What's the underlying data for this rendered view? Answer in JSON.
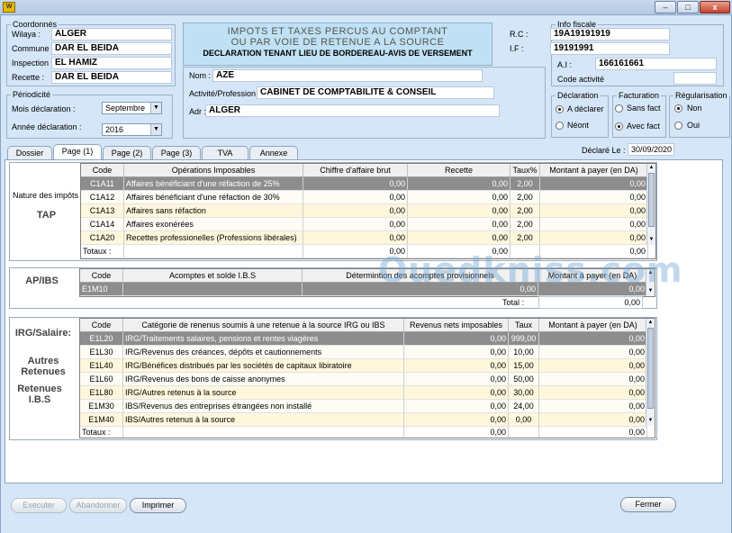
{
  "window": {
    "buttons": {
      "minimize": "–",
      "maximize": "□",
      "close": "x"
    }
  },
  "coordonnees": {
    "legend": "Coordonnés",
    "wilaya_label": "Wilaya :",
    "wilaya": "ALGER",
    "commune_label": "Commune :",
    "commune": "DAR EL BEIDA",
    "inspection_label": "Inspection :",
    "inspection": "EL HAMIZ",
    "recette_label": "Recette :",
    "recette": "DAR EL BEIDA"
  },
  "header": {
    "line1": "IMPOTS ET TAXES PERCUS AU COMPTANT",
    "line2": "OU PAR VOIE DE RETENUE A LA SOURCE",
    "line3": "DECLARATION TENANT LIEU DE BORDEREAU-AVIS DE VERSEMENT"
  },
  "identite": {
    "nom_label": "Nom :",
    "nom": "AZE",
    "activite_label": "Activité/Profession :",
    "activite": "CABINET DE COMPTABILITE & CONSEIL",
    "adr_label": "Adr :",
    "adr": "ALGER"
  },
  "info_fiscale": {
    "legend": "Info fiscale",
    "rc_label": "R.C :",
    "rc": "19A19191919",
    "if_label": "I.F :",
    "if": "19191991",
    "ai_label": "A.I :",
    "ai": "166161661",
    "code_activite_label": "Code activité",
    "code_activite": ""
  },
  "periodicite": {
    "legend": "Périodicité",
    "mois_label": "Mois déclaration :",
    "mois": "Septembre",
    "annee_label": "Année déclaration :",
    "annee": "2016"
  },
  "declaration": {
    "legend": "Déclaration",
    "a_declarer": "A déclarer",
    "neant": "Néont",
    "selected": "A déclarer"
  },
  "facturation": {
    "legend": "Facturation",
    "sans_fact": "Sans fact",
    "avec_fact": "Avec fact",
    "selected": "Avec fact"
  },
  "regularisation": {
    "legend": "Régularisation",
    "non": "Non",
    "oui": "Oui",
    "selected": "Non"
  },
  "declare_le": {
    "label": "Déclaré Le :",
    "date": "30/09/2020"
  },
  "tabs": [
    "Dossier",
    "Page (1)",
    "Page (2)",
    "Page (3)",
    "TVA",
    "Annexe"
  ],
  "active_tab": "Page (1)",
  "tap": {
    "label_top": "Nature des impôts",
    "label_main": "TAP",
    "columns": [
      "Code",
      "Opérations Imposables",
      "Chiffre d'affaire brut",
      "Recette",
      "Taux%",
      "Montant à payer (en DA)"
    ],
    "rows": [
      [
        "C1A11",
        "Affaires bénéficiant d'une réfaction de 25%",
        "0,00",
        "0,00",
        "2,00",
        "0,00"
      ],
      [
        "C1A12",
        "Affaires bénéficiant d'une réfaction de 30%",
        "0,00",
        "0,00",
        "2,00",
        "0,00"
      ],
      [
        "C1A13",
        "Affaires sans réfaction",
        "0,00",
        "0,00",
        "2,00",
        "0,00"
      ],
      [
        "C1A14",
        "Affaires exonérées",
        "0,00",
        "0,00",
        "2,00",
        "0,00"
      ],
      [
        "C1A20",
        "Recettes professionelles (Professions libérales)",
        "0,00",
        "0,00",
        "2,00",
        "0,00"
      ]
    ],
    "totals_label": "Totaux :",
    "totals": [
      "0,00",
      "0,00",
      "0,00"
    ]
  },
  "apibs": {
    "label": "AP/IBS",
    "columns": [
      "Code",
      "Acomptes et solde I.B.S",
      "Détermintion des acomptes provisionnels",
      "Montant à payer (en DA)"
    ],
    "rows": [
      [
        "E1M10",
        "",
        "0,00",
        "0,00"
      ]
    ],
    "total_label": "Total :",
    "total": "0,00"
  },
  "irg": {
    "label_irg": "IRG/Salaire:",
    "label_autres": "Autres\nRetenues",
    "label_ibs": "Retenues\nI.B.S",
    "columns": [
      "Code",
      "Catégorie de renenus soumis à une retenue à la source IRG ou IBS",
      "Revenus nets imposables",
      "Taux",
      "Montant à payer (en DA)"
    ],
    "rows": [
      [
        "E1L20",
        "IRG/Traitements salaires, pensions et rentes viagères",
        "0,00",
        "999,00",
        "0,00"
      ],
      [
        "E1L30",
        "IRG/Revenus des créances, dépôts et cautionnements",
        "0,00",
        "10,00",
        "0,00"
      ],
      [
        "E1L40",
        "IRG/Bénéfices distribués par les sociétés de capitaux libiratoire",
        "0,00",
        "15,00",
        "0,00"
      ],
      [
        "E1L60",
        "IRG/Revenus des bons de caisse anonymes",
        "0,00",
        "50,00",
        "0,00"
      ],
      [
        "E1L80",
        "IRG/Autres retenus à la source",
        "0,00",
        "30,00",
        "0,00"
      ],
      [
        "E1M30",
        "IBS/Revenus des entreprises étrangées non installé",
        "0,00",
        "24,00",
        "0,00"
      ],
      [
        "E1M40",
        "IBS/Autres retenus à la source",
        "0,00",
        "0,00",
        "0,00"
      ]
    ],
    "totals_label": "Totaux :",
    "totals": [
      "0,00",
      "0,00"
    ]
  },
  "footer": {
    "executer": "Executer",
    "abandonner": "Abandonner",
    "imprimer": "Imprimer",
    "fermer": "Fermer"
  },
  "watermark": "Ouedkniss.com"
}
